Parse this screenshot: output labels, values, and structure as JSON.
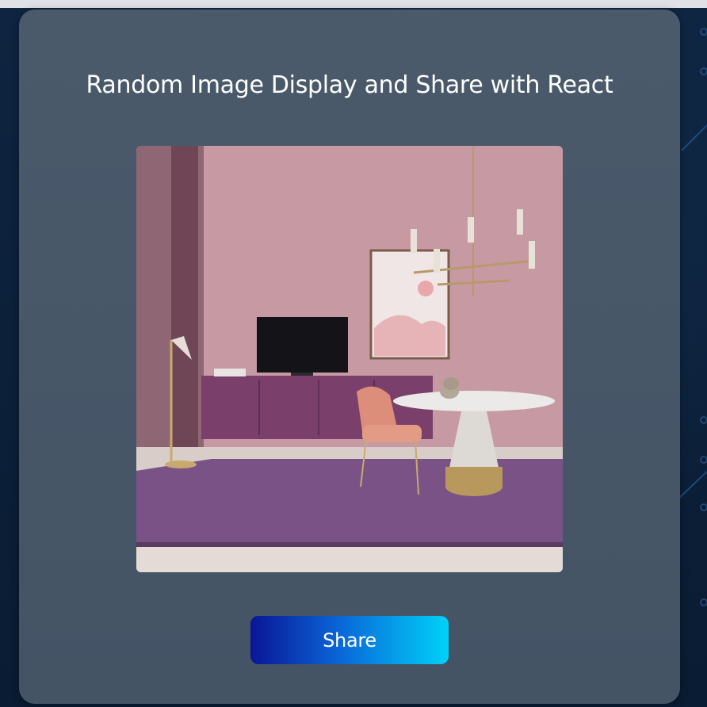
{
  "page": {
    "title": "Random Image Display and Share with React"
  },
  "image": {
    "icon": "room-photo",
    "description": ""
  },
  "actions": {
    "share_label": "Share"
  },
  "colors": {
    "background": "#0b1f35",
    "card": "#4a5a6b",
    "button_start": "#0a1596",
    "button_end": "#00d2f8",
    "title_text": "#ffffff"
  }
}
